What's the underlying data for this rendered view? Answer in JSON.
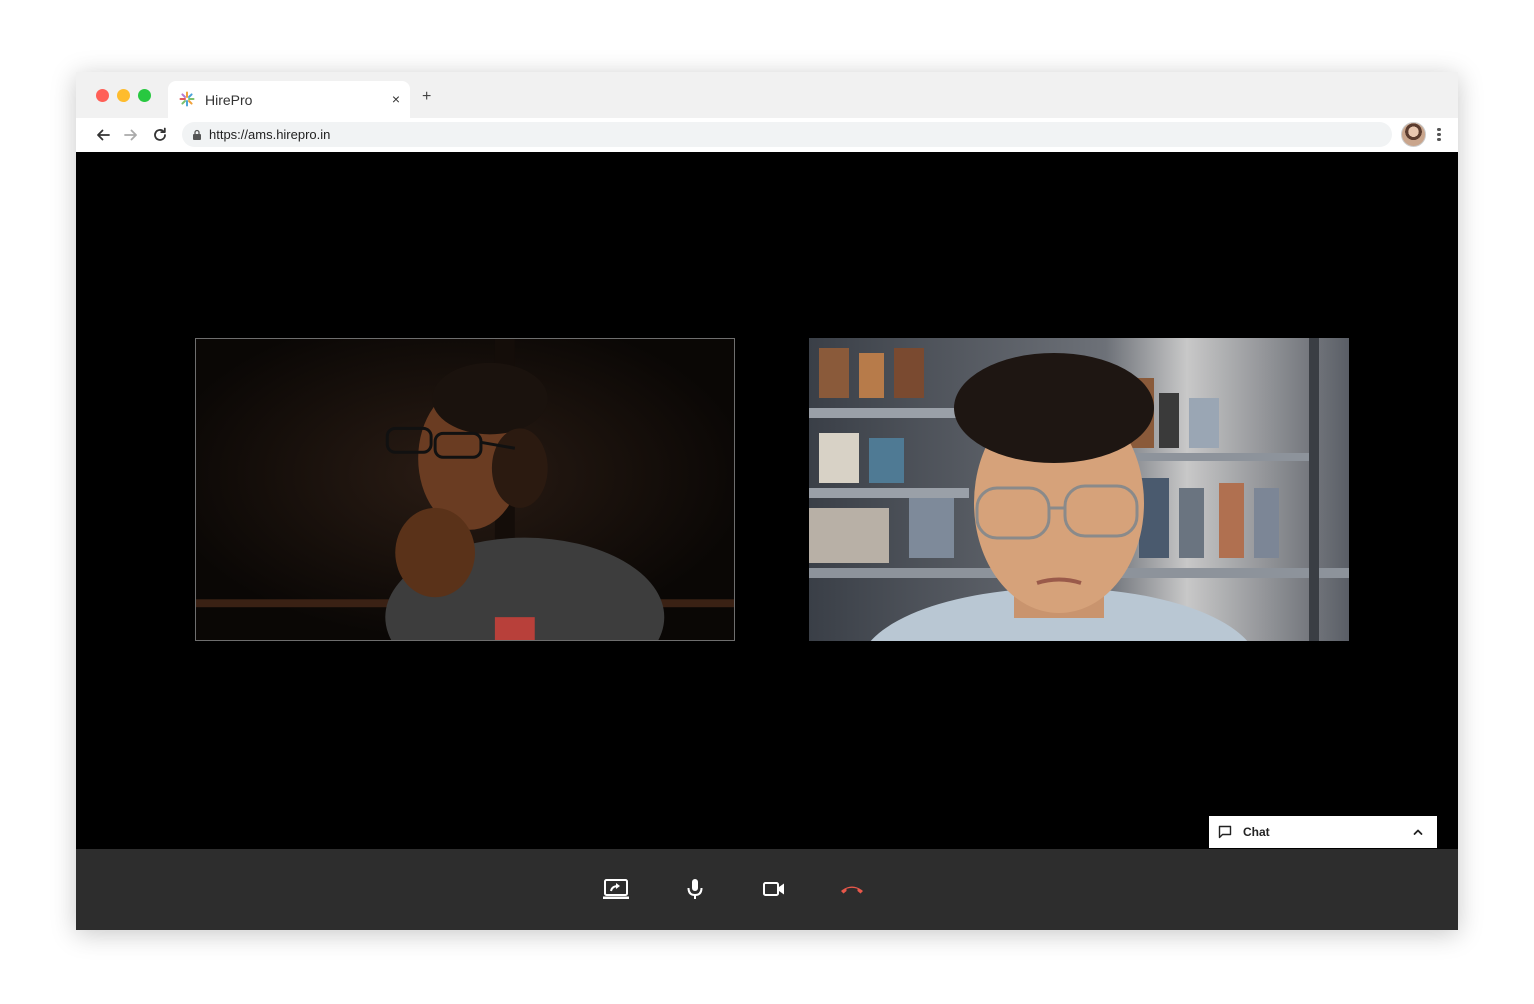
{
  "browser": {
    "tab": {
      "title": "HirePro",
      "close_glyph": "×",
      "favicon": "hirepro-logo-icon"
    },
    "new_tab_glyph": "+",
    "address": {
      "url": "https://ams.hirepro.in"
    },
    "icons": [
      "back-arrow-icon",
      "forward-arrow-icon",
      "reload-icon",
      "lock-icon",
      "profile-avatar",
      "more-vert-icon"
    ]
  },
  "meeting": {
    "participants": [
      {
        "tile": "left",
        "description_icon": "video-feed"
      },
      {
        "tile": "right",
        "description_icon": "video-feed"
      }
    ],
    "chat": {
      "label": "Chat",
      "icon": "chat-bubble-icon",
      "toggle_icon": "chevron-up-icon"
    },
    "controls": [
      {
        "name": "share-screen-button",
        "icon": "present-screen-icon"
      },
      {
        "name": "microphone-button",
        "icon": "mic-icon"
      },
      {
        "name": "camera-button",
        "icon": "videocam-icon"
      },
      {
        "name": "hang-up-button",
        "icon": "call-end-icon"
      }
    ]
  },
  "colors": {
    "control_bar": "#2d2d2d",
    "hangup": "#e8574a",
    "control_icon": "#ffffff"
  }
}
